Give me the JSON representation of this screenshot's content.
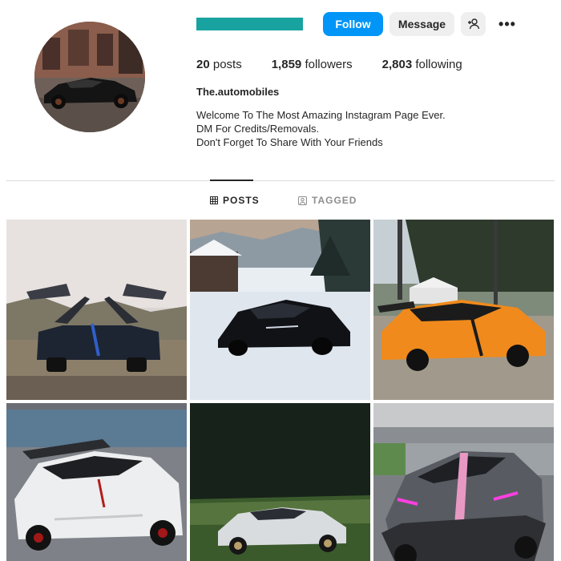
{
  "profile": {
    "username_bar_color": "#18a3a0",
    "full_name": "The.automobiles",
    "bio": [
      "Welcome To The Most Amazing Instagram Page Ever.",
      "DM For Credits/Removals.",
      "Don't Forget To Share With Your Friends"
    ],
    "avatar": "black-supercar-photo"
  },
  "actions": {
    "follow_label": "Follow",
    "message_label": "Message",
    "add_user_icon": "add-user-icon",
    "more_icon": "more-horizontal-icon",
    "more_glyph": "•••"
  },
  "stats": {
    "posts_count": "20",
    "posts_label": "posts",
    "followers_count": "1,859",
    "followers_label": "followers",
    "following_count": "2,803",
    "following_label": "following"
  },
  "tabs": {
    "posts_label": "POSTS",
    "posts_icon": "grid-icon",
    "tagged_label": "TAGGED",
    "tagged_icon": "tagged-icon",
    "active": "posts"
  },
  "posts": [
    {
      "subject": "Pagani Huayra roadster, gullwing doors open, hillside"
    },
    {
      "subject": "Black Bugatti Chiron in snow, chalet and pine trees"
    },
    {
      "subject": "Orange Koenigsegg Jesko, forest and white tents"
    },
    {
      "subject": "White Lamborghini Huracan Performante spyder by lake"
    },
    {
      "subject": "Silver Pagani Utopia in green field"
    },
    {
      "subject": "Gray Dodge Charger with pink stripe and neon underglow"
    }
  ],
  "colors": {
    "accent": "#0095f6",
    "secondary_button": "#efefef",
    "text": "#262626",
    "muted": "#8e8e8e",
    "divider": "#dbdbdb"
  }
}
